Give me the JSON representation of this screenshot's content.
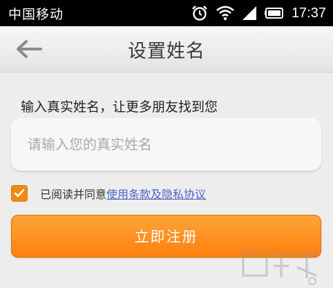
{
  "status_bar": {
    "carrier": "中国移动",
    "time": "17:37",
    "icons": [
      "alarm-icon",
      "wifi-icon",
      "signal-icon",
      "battery-icon"
    ]
  },
  "top_bar": {
    "back_icon": "arrow-left-icon",
    "title": "设置姓名"
  },
  "form": {
    "hint": "输入真实姓名，让更多朋友找到您",
    "name_input": {
      "value": "",
      "placeholder": "请输入您的真实姓名"
    },
    "agree": {
      "checked": true,
      "text": "已阅读并同意",
      "link": "使用条款及隐私协议"
    },
    "register_label": "立即注册"
  },
  "colors": {
    "accent": "#ff8a1f",
    "link": "#4a62c9",
    "background": "#ededed"
  }
}
